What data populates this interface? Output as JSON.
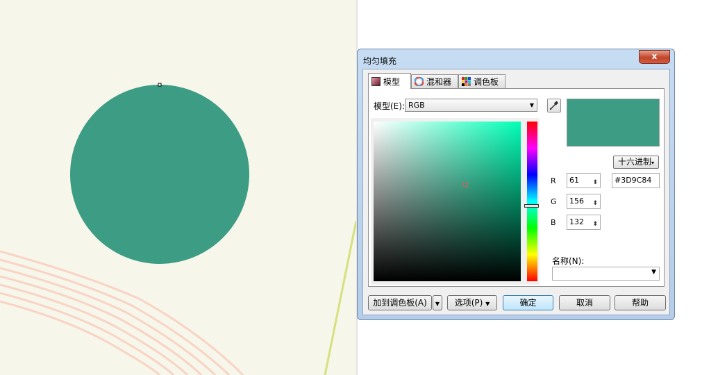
{
  "dialog": {
    "title": "均匀填充",
    "close_label": "x",
    "tabs": [
      {
        "label": "模型",
        "icon": "model-icon"
      },
      {
        "label": "混和器",
        "icon": "mixer-icon"
      },
      {
        "label": "调色板",
        "icon": "palette-icon"
      }
    ],
    "model_label": "模型(E):",
    "model_value": "RGB",
    "eyedropper_icon": "eyedropper-icon",
    "preview_color": "#3D9C84",
    "hex_button_label": "十六进制",
    "channels": [
      {
        "label": "R",
        "value": "61"
      },
      {
        "label": "G",
        "value": "156"
      },
      {
        "label": "B",
        "value": "132"
      }
    ],
    "hex_value": "#3D9C84",
    "name_label": "名称(N):",
    "name_value": "",
    "buttons": {
      "add_to_palette": "加到调色板(A)",
      "options": "选项(P)",
      "ok": "确定",
      "cancel": "取消",
      "help": "帮助"
    }
  },
  "canvas": {
    "background_color": "#F6F6EA",
    "circle_color": "#3D9C84",
    "stripe_color": "#F9D3C4",
    "line_color": "#D6E07E"
  }
}
